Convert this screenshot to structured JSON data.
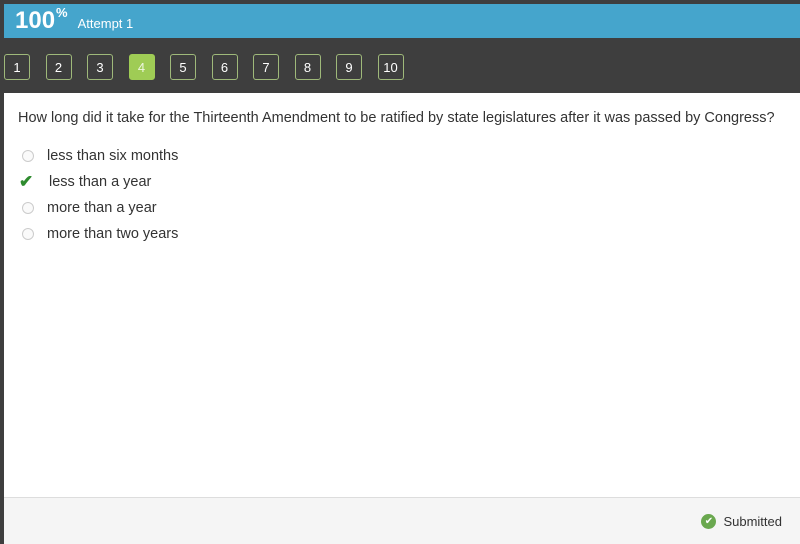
{
  "header": {
    "score": "100",
    "score_unit": "%",
    "attempt": "Attempt 1"
  },
  "nav": {
    "questions": [
      "1",
      "2",
      "3",
      "4",
      "5",
      "6",
      "7",
      "8",
      "9",
      "10"
    ],
    "active_index": 3
  },
  "question": {
    "text": "How long did it take for the Thirteenth Amendment to be ratified by state legislatures after it was passed by Congress?",
    "options": [
      {
        "label": "less than six months",
        "state": "unselected"
      },
      {
        "label": "less than a year",
        "state": "correct"
      },
      {
        "label": "more than a year",
        "state": "unselected"
      },
      {
        "label": "more than two years",
        "state": "unselected"
      }
    ]
  },
  "footer": {
    "status": "Submitted",
    "status_color": "#6aa84f"
  }
}
